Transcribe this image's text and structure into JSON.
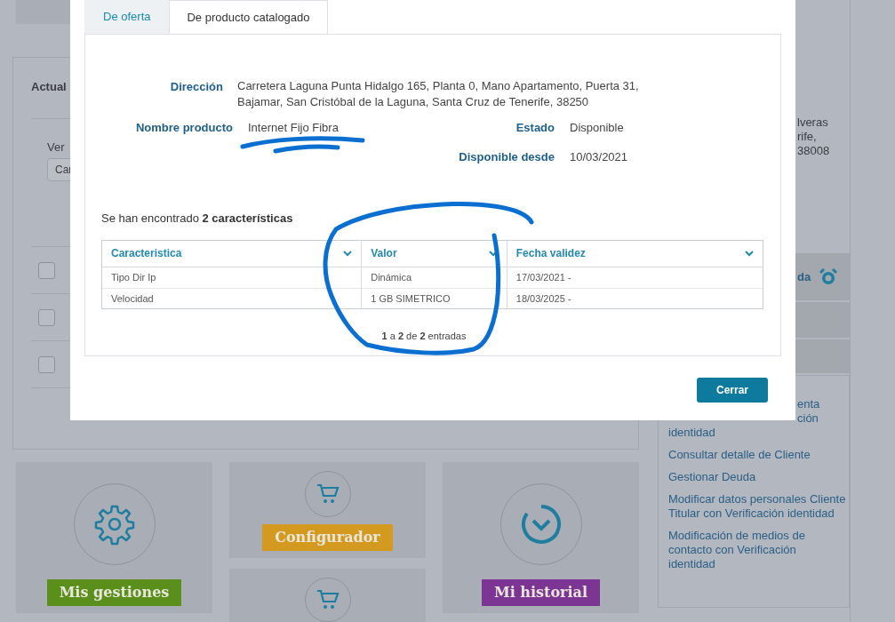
{
  "background": {
    "card_title": "Actual",
    "view_label": "Ver",
    "view_select": "Car",
    "checkbox_rows": [
      {
        "checked": false
      },
      {
        "checked": false
      },
      {
        "checked": false
      }
    ],
    "right_text": [
      "lveras",
      "rife,",
      "38008"
    ],
    "alarm_item": "da",
    "partial_link_lines": [
      "enta",
      "ción"
    ],
    "links": [
      "identidad",
      "Consultar detalle de Cliente",
      "Gestionar Deuda",
      "Modificar datos personales Cliente Titular con Verificación identidad",
      "Modificación de medios de contacto con Verificación identidad"
    ],
    "tiles": [
      {
        "kind": "gear",
        "label": "Mis gestiones",
        "color": "#5b8f1c"
      },
      {
        "kind": "cart",
        "label": "Configurador",
        "color": "#d49a20"
      },
      {
        "kind": "cart"
      },
      {
        "kind": "clock",
        "label": "Mi historial",
        "color": "#7d3594"
      }
    ]
  },
  "modal": {
    "tabs": [
      {
        "label": "De oferta",
        "selected": false
      },
      {
        "label": "De producto catalogado",
        "selected": true
      }
    ],
    "address": {
      "label": "Dirección",
      "value": "Carretera Laguna Punta Hidalgo 165, Planta 0, Mano Apartamento, Puerta 31, Bajamar, San Cristóbal de la Laguna, Santa Cruz de Tenerife, 38250"
    },
    "product": {
      "label": "Nombre producto",
      "value": "Internet Fijo Fibra"
    },
    "status": {
      "label": "Estado",
      "value": "Disponible"
    },
    "available_from": {
      "label": "Disponible desde",
      "value": "10/03/2021"
    },
    "summary": "Se han encontrado **2 características**",
    "table": {
      "columns": [
        "Caracteristica",
        "Valor",
        "Fecha validez"
      ],
      "rows": [
        [
          "Tipo Dir Ip",
          "Dinámica",
          "17/03/2021 -"
        ],
        [
          "Velocidad",
          "1 GB SIMETRICO",
          "18/03/2025 -"
        ]
      ]
    },
    "pagination": "**1** a **2** de **2** entradas",
    "close_button": "Cerrar"
  }
}
